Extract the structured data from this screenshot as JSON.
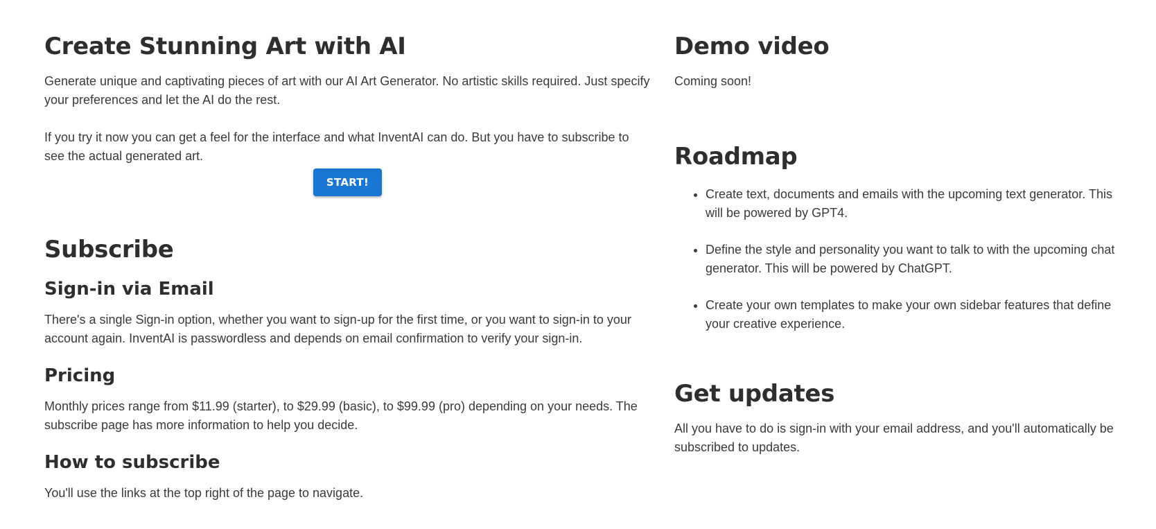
{
  "hero": {
    "title": "Create Stunning Art with AI",
    "p1": "Generate unique and captivating pieces of art with our AI Art Generator. No artistic skills required. Just specify your preferences and let the AI do the rest.",
    "p2": "If you try it now you can get a feel for the interface and what InventAI can do. But you have to subscribe to see the actual generated art.",
    "start_label": "START!"
  },
  "subscribe": {
    "title": "Subscribe",
    "signin_title": "Sign-in via Email",
    "signin_text": "There's a single Sign-in option, whether you want to sign-up for the first time, or you want to sign-in to your account again. InventAI is passwordless and depends on email confirmation to verify your sign-in.",
    "pricing_title": "Pricing",
    "pricing_text": "Monthly prices range from $11.99 (starter), to $29.99 (basic), to $99.99 (pro) depending on your needs. The subscribe page has more information to help you decide.",
    "how_title": "How to subscribe",
    "how_text": "You'll use the links at the top right of the page to navigate."
  },
  "demo": {
    "title": "Demo video",
    "text": "Coming soon!"
  },
  "roadmap": {
    "title": "Roadmap",
    "items": [
      "Create text, documents and emails with the upcoming text generator. This will be powered by GPT4.",
      "Define the style and personality you want to talk to with the upcoming chat generator. This will be powered by ChatGPT.",
      "Create your own templates to make your own sidebar features that define your creative experience."
    ]
  },
  "updates": {
    "title": "Get updates",
    "text": "All you have to do is sign-in with your email address, and you'll automatically be subscribed to updates."
  },
  "colors": {
    "accent": "#1976d2",
    "text": "#333333",
    "background": "#ffffff"
  }
}
